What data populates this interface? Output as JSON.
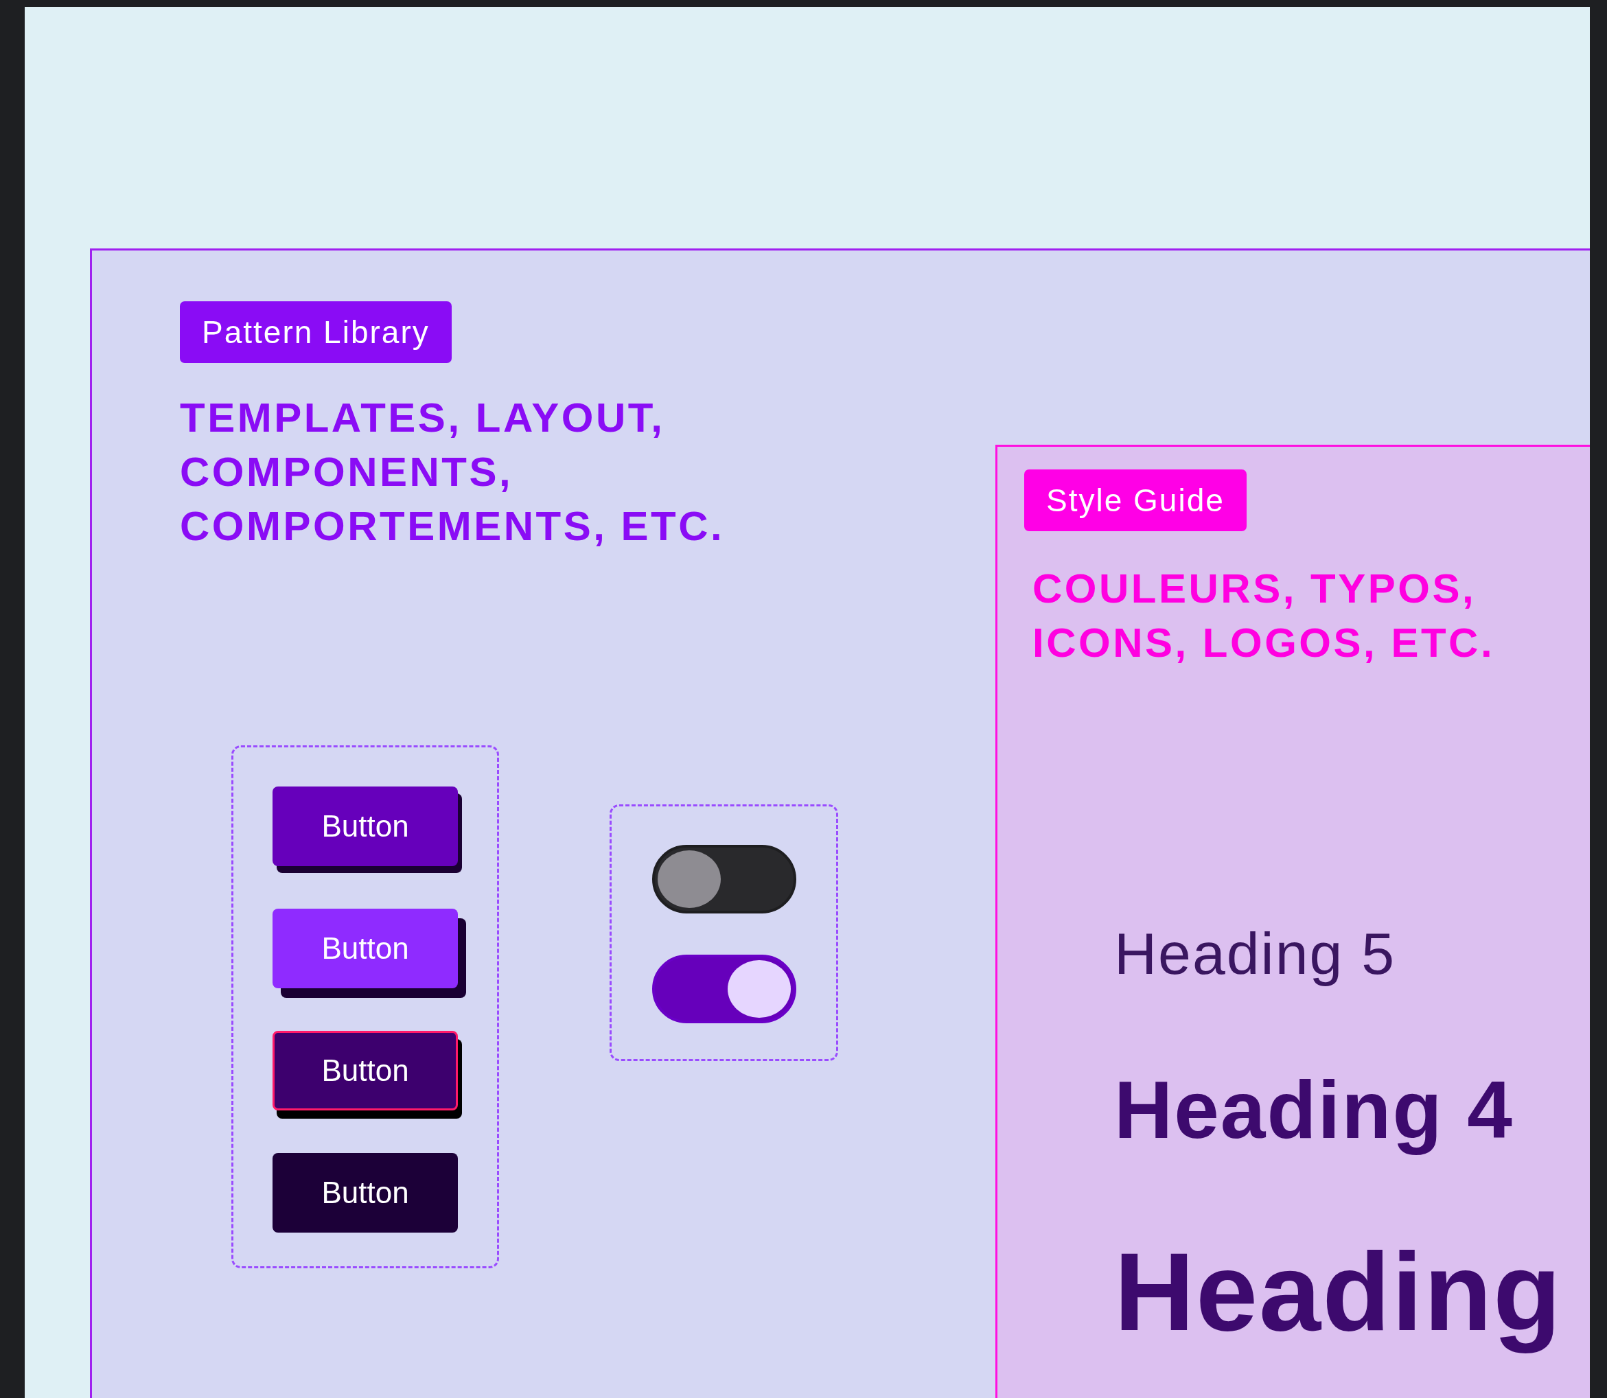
{
  "pattern_library": {
    "badge": "Pattern Library",
    "description": "TEMPLATES, LAYOUT,\nCOMPONENTS,\nCOMPORTEMENTS, ETC.",
    "buttons": [
      {
        "label": "Button",
        "kind": "primary"
      },
      {
        "label": "Button",
        "kind": "hover"
      },
      {
        "label": "Button",
        "kind": "focus"
      },
      {
        "label": "Button",
        "kind": "pressed"
      }
    ],
    "toggles": [
      {
        "on": false
      },
      {
        "on": true
      }
    ]
  },
  "style_guide": {
    "badge": "Style Guide",
    "description": "COULEURS, TYPOS,\nICONS, LOGOS, ETC.",
    "headings": [
      {
        "text": "Heading 5",
        "kind": "h5"
      },
      {
        "text": "Heading 4",
        "kind": "h4"
      },
      {
        "text": "Heading",
        "kind": "h3"
      }
    ]
  }
}
